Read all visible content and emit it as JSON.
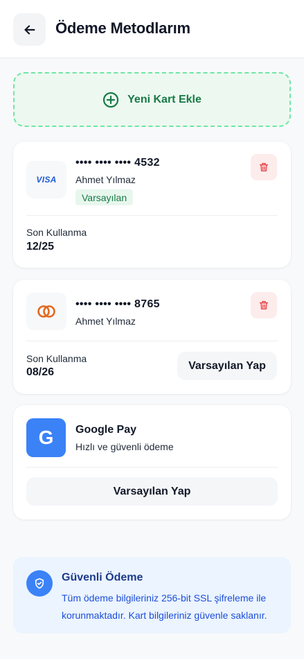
{
  "header": {
    "title": "Ödeme Metodlarım",
    "back_icon": "arrow-left-icon"
  },
  "add_card": {
    "label": "Yeni Kart Ekle",
    "icon": "plus-circle-icon"
  },
  "cards": [
    {
      "brand": "VISA",
      "number": "•••• •••• •••• 4532",
      "holder": "Ahmet Yılmaz",
      "default_badge": "Varsayılan",
      "expiry_label": "Son Kullanma",
      "expiry": "12/25",
      "delete_icon": "trash-icon"
    },
    {
      "brand_icon": "mastercard-icon",
      "number": "•••• •••• •••• 8765",
      "holder": "Ahmet Yılmaz",
      "expiry_label": "Son Kullanma",
      "expiry": "08/26",
      "make_default_label": "Varsayılan Yap",
      "delete_icon": "trash-icon"
    }
  ],
  "google_pay": {
    "logo_letter": "G",
    "title": "Google Pay",
    "subtitle": "Hızlı ve güvenli ödeme",
    "make_default_label": "Varsayılan Yap"
  },
  "security": {
    "icon": "shield-check-icon",
    "title": "Güvenli Ödeme",
    "text": "Tüm ödeme bilgileriniz 256-bit SSL şifreleme ile korunmaktadır. Kart bilgileriniz güvenle saklanır."
  },
  "colors": {
    "accent_green": "#177a45",
    "accent_blue": "#3b82f6",
    "danger": "#e5484d",
    "mastercard": "#e2691f"
  }
}
